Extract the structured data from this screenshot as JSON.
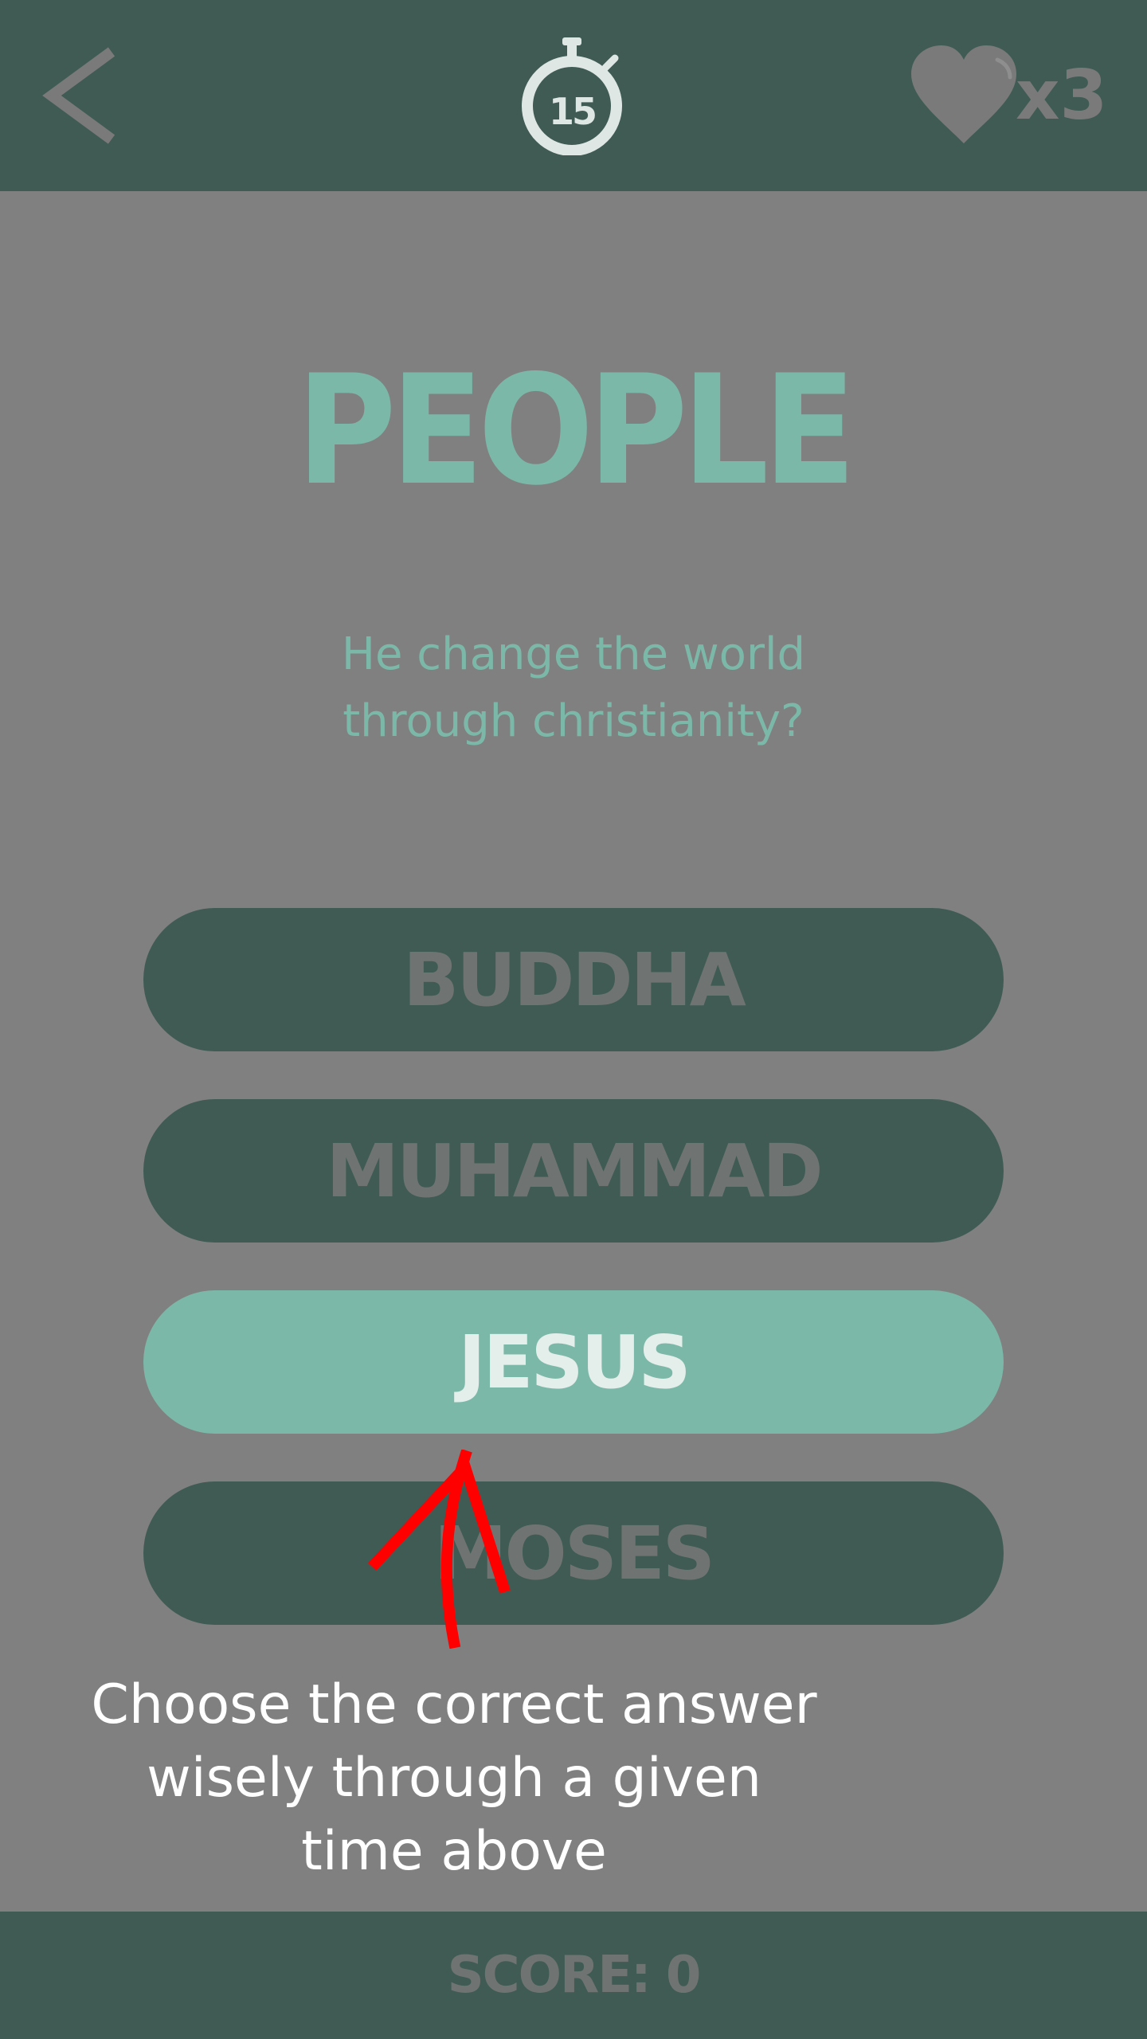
{
  "header": {
    "back_icon": "chevron-left-icon",
    "timer_icon": "stopwatch-icon",
    "timer_seconds": "15",
    "lives_icon": "heart-icon",
    "lives_count": "x3"
  },
  "quiz": {
    "category": "PEOPLE",
    "question_line1": "He change the world",
    "question_line2": "through christianity?",
    "answers": [
      {
        "label": "BUDDHA",
        "selected": false
      },
      {
        "label": "MUHAMMAD",
        "selected": false
      },
      {
        "label": "JESUS",
        "selected": true
      },
      {
        "label": "MOSES",
        "selected": false
      }
    ]
  },
  "tutorial": {
    "arrow_icon": "arrow-up-icon",
    "hint_line1": "Choose the correct answer",
    "hint_line2": "wisely through a given",
    "hint_line3": "time above"
  },
  "footer": {
    "score_text": "SCORE: 0"
  },
  "colors": {
    "bar": "#3f5b54",
    "overlay_gray": "#808080",
    "accent": "#7cb8a8",
    "arrow": "#ff0000"
  }
}
